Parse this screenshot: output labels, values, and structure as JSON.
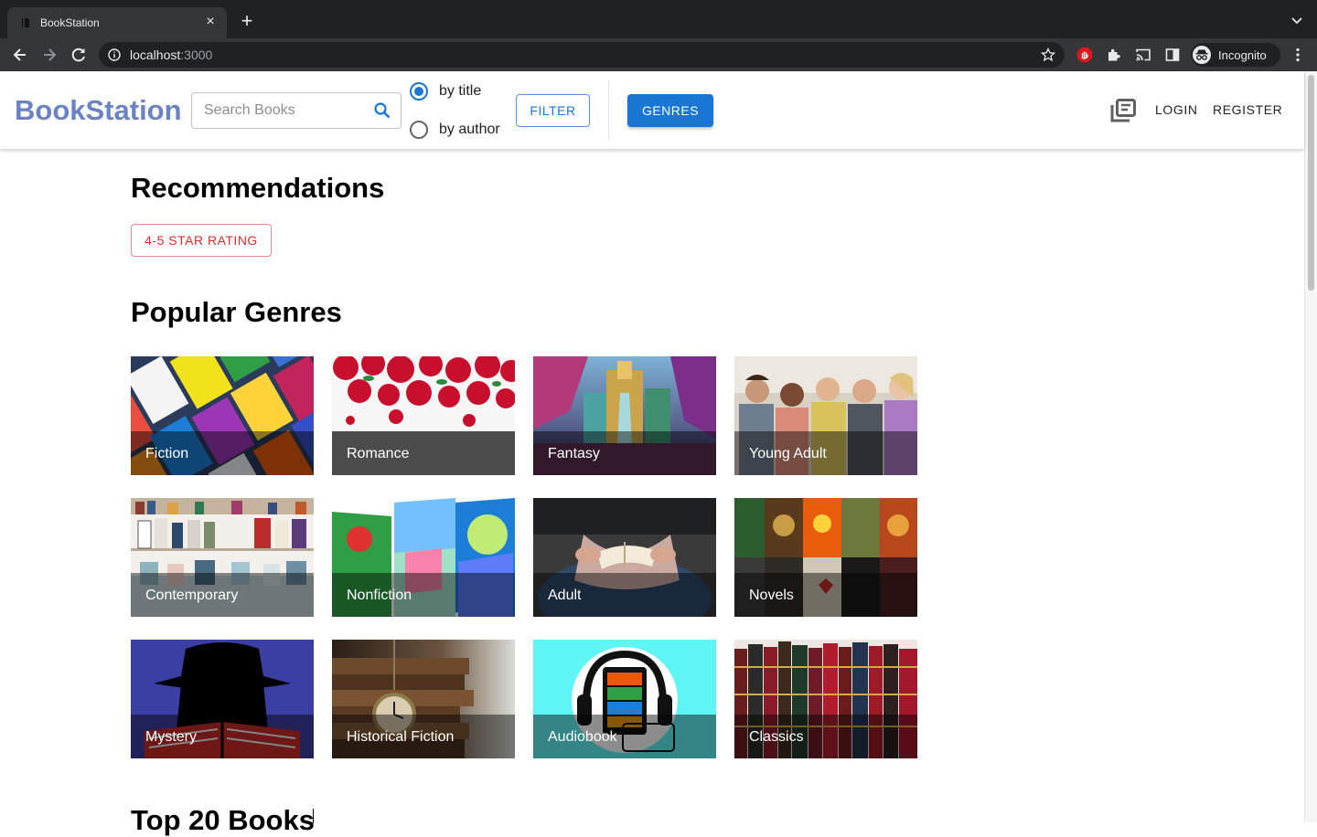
{
  "browser": {
    "tab_title": "BookStation",
    "tab_close": "×",
    "new_tab": "+",
    "url_host": "localhost",
    "url_port": ":3000",
    "profile_label": "Incognito"
  },
  "header": {
    "brand": "BookStation",
    "search_placeholder": "Search Books",
    "search_by": [
      {
        "label": "by title",
        "selected": true
      },
      {
        "label": "by author",
        "selected": false
      }
    ],
    "filter_label": "FILTER",
    "genres_label": "GENRES",
    "login_label": "LOGIN",
    "register_label": "REGISTER"
  },
  "recommendations": {
    "heading": "Recommendations",
    "rating_filter": "4-5 STAR RATING"
  },
  "popular_genres": {
    "heading": "Popular Genres",
    "items": [
      {
        "label": "Fiction",
        "art": "book-covers"
      },
      {
        "label": "Romance",
        "art": "roses"
      },
      {
        "label": "Fantasy",
        "art": "fantasy-city"
      },
      {
        "label": "Young Adult",
        "art": "group-of-friends"
      },
      {
        "label": "Contemporary",
        "art": "bookstore-shelves"
      },
      {
        "label": "Nonfiction",
        "art": "colorful-books"
      },
      {
        "label": "Adult",
        "art": "reading-hands"
      },
      {
        "label": "Novels",
        "art": "novel-covers"
      },
      {
        "label": "Mystery",
        "art": "detective-reader"
      },
      {
        "label": "Historical Fiction",
        "art": "old-books-pocketwatch"
      },
      {
        "label": "Audiobook",
        "art": "headphones-tablet"
      },
      {
        "label": "Classics",
        "art": "leather-classics"
      }
    ]
  },
  "top_books": {
    "heading": "Top 20 Books"
  },
  "colors": {
    "brand": "#6b83c4",
    "primary": "#1976d2",
    "rating_accent": "#d32f2f"
  }
}
